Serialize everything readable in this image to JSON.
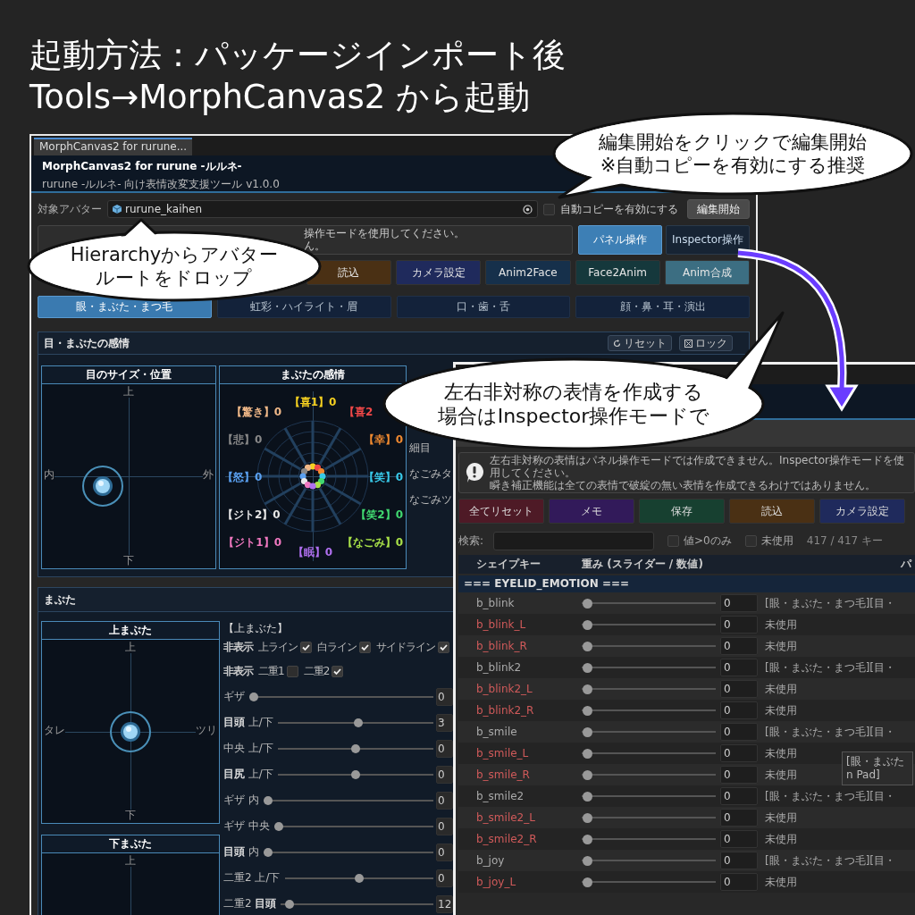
{
  "headline": [
    "起動方法：パッケージインポート後",
    "Tools→MorphCanvas2 から起動"
  ],
  "main_window": {
    "tab": "MorphCanvas2 for rurune...",
    "title": "MorphCanvas2 for rurune -ルルネ-",
    "subtitle": "rurune -ルルネ- 向け表情改変支援ツール v1.0.0",
    "avatar_label": "対象アバター",
    "avatar_field": {
      "value": "rurune_kaihen"
    },
    "auto_copy": {
      "label": "自動コピーを有効にする",
      "checked": false
    },
    "start_button": "編集開始",
    "notice": [
      "操作モードを使用してください。",
      "ん。"
    ],
    "modes": [
      {
        "label": "パネル操作",
        "selected": true
      },
      {
        "label": "Inspector操作",
        "selected": false
      }
    ],
    "buttons": [
      {
        "label": "読込",
        "color": "#4a3014"
      },
      {
        "label": "カメラ設定",
        "color": "#1f2a5c"
      },
      {
        "label": "Anim2Face",
        "color": "#16304b"
      },
      {
        "label": "Face2Anim",
        "color": "#15383c"
      },
      {
        "label": "Anim合成",
        "color": "#3c6e82"
      }
    ],
    "categories": [
      {
        "label": "眼・まぶた・まつ毛",
        "selected": true
      },
      {
        "label": "虹彩・ハイライト・眉",
        "selected": false
      },
      {
        "label": "口・歯・舌",
        "selected": false
      },
      {
        "label": "顔・鼻・耳・演出",
        "selected": false
      }
    ],
    "eye_emotion": {
      "title": "目・まぶたの感情",
      "actions": [
        "リセット",
        "ロック"
      ],
      "position_pad": {
        "title": "目のサイズ・位置",
        "top": "上",
        "left": "内",
        "right": "外",
        "bottom": "下"
      },
      "radar": {
        "title": "まぶたの感情",
        "emotions": [
          {
            "label": "【喜1】0",
            "color": "#f5d020"
          },
          {
            "label": "【驚き】0",
            "color": "#f0b888"
          },
          {
            "label": "【喜2",
            "color": "#f04848"
          },
          {
            "label": "【悲】0",
            "color": "#888888"
          },
          {
            "label": "【幸】0",
            "color": "#f08a30"
          },
          {
            "label": "【怒】0",
            "color": "#5aa0f0"
          },
          {
            "label": "【笑】0",
            "color": "#38c8e8"
          },
          {
            "label": "【ジト2】0",
            "color": "#e8e8e8"
          },
          {
            "label": "【笑2】0",
            "color": "#40d870"
          },
          {
            "label": "【ジト1】0",
            "color": "#f078c0"
          },
          {
            "label": "【なごみ】0",
            "color": "#a8e048"
          },
          {
            "label": "【眠】0",
            "color": "#b070f0"
          }
        ]
      },
      "side_labels": [
        "細目",
        "なごみタ",
        "なごみツ"
      ]
    },
    "eyelid": {
      "title": "まぶた",
      "upper_pad": {
        "title": "上まぶた",
        "top": "上",
        "left": "タレ",
        "right": "ツリ",
        "bottom": "下"
      },
      "lower_pad": {
        "title": "下まぶた",
        "top": "上"
      },
      "heading": "【上まぶた】",
      "hide_rows": [
        {
          "label": "非表示",
          "options": [
            {
              "label": "上ライン",
              "checked": true
            },
            {
              "label": "白ライン",
              "checked": true
            },
            {
              "label": "サイドライン",
              "checked": true
            }
          ]
        },
        {
          "label": "非表示",
          "options": [
            {
              "label": "二重1",
              "checked": false
            },
            {
              "label": "二重2",
              "checked": true
            }
          ]
        }
      ],
      "sliders": [
        {
          "label": "ギザ",
          "level": 0,
          "value": "0"
        },
        {
          "label": "**目頭** 上/下",
          "level": 0.52,
          "value": "3"
        },
        {
          "label": "中央 上/下",
          "level": 0.5,
          "value": "0"
        },
        {
          "label": "**目尻** 上/下",
          "level": 0.5,
          "value": "0"
        },
        {
          "label": "ギザ 内",
          "level": 0,
          "value": "0"
        },
        {
          "label": "ギザ 中央",
          "level": 0,
          "value": "0"
        },
        {
          "label": "**目頭** 内",
          "level": 0,
          "value": "0"
        },
        {
          "label": "二重2 上/下",
          "level": 0.5,
          "value": "0"
        },
        {
          "label": "二重2 **目頭**",
          "level": 0.03,
          "value": "12"
        }
      ]
    }
  },
  "inspector_window": {
    "notice": [
      "左右非対称の表情はパネル操作モードでは作成できません。Inspector操作モードを使用してください。",
      "瞬き補正機能は全ての表情で破綻の無い表情を作成できるわけではありません。"
    ],
    "buttons": [
      {
        "label": "全てリセット",
        "color": "#4e1a26"
      },
      {
        "label": "メモ",
        "color": "#321a5a"
      },
      {
        "label": "保存",
        "color": "#174030"
      },
      {
        "label": "読込",
        "color": "#4a3014"
      },
      {
        "label": "カメラ設定",
        "color": "#1f2a5c"
      }
    ],
    "search": {
      "label": "検索:"
    },
    "filters": [
      {
        "label": "値>0のみ",
        "checked": false
      },
      {
        "label": "未使用",
        "checked": false
      }
    ],
    "count": "417 / 417 キー",
    "columns": [
      "シェイプキー",
      "重み (スライダー / 数値)",
      "パ"
    ],
    "group": "=== EYELID_EMOTION ===",
    "rows": [
      {
        "name": "b_blink",
        "unused": false,
        "level": 0,
        "value": "0",
        "panel": "[眼・まぶた・まつ毛][目・"
      },
      {
        "name": "b_blink_L",
        "unused": true,
        "level": 0,
        "value": "0",
        "panel": "未使用"
      },
      {
        "name": "b_blink_R",
        "unused": true,
        "level": 0,
        "value": "0",
        "panel": "未使用"
      },
      {
        "name": "b_blink2",
        "unused": false,
        "level": 0,
        "value": "0",
        "panel": "[眼・まぶた・まつ毛][目・"
      },
      {
        "name": "b_blink2_L",
        "unused": true,
        "level": 0,
        "value": "0",
        "panel": "未使用"
      },
      {
        "name": "b_blink2_R",
        "unused": true,
        "level": 0,
        "value": "0",
        "panel": "未使用"
      },
      {
        "name": "b_smile",
        "unused": false,
        "level": 0,
        "value": "0",
        "panel": "[眼・まぶた・まつ毛][目・"
      },
      {
        "name": "b_smile_L",
        "unused": true,
        "level": 0,
        "value": "0",
        "panel": "未使用"
      },
      {
        "name": "b_smile_R",
        "unused": true,
        "level": 0,
        "value": "0",
        "panel": "未使用"
      },
      {
        "name": "b_smile2",
        "unused": false,
        "level": 0,
        "value": "0",
        "panel": "[眼・まぶた・まつ毛][目・"
      },
      {
        "name": "b_smile2_L",
        "unused": true,
        "level": 0,
        "value": "0",
        "panel": "未使用"
      },
      {
        "name": "b_smile2_R",
        "unused": true,
        "level": 0,
        "value": "0",
        "panel": "未使用"
      },
      {
        "name": "b_joy",
        "unused": false,
        "level": 0,
        "value": "0",
        "panel": "[眼・まぶた・まつ毛][目・"
      },
      {
        "name": "b_joy_L",
        "unused": true,
        "level": 0,
        "value": "0",
        "panel": "未使用"
      }
    ],
    "tooltip": [
      "[眼・まぶた",
      "n Pad]"
    ]
  },
  "callouts": [
    {
      "text": [
        "編集開始をクリックで編集開始",
        "※自動コピーを有効にする推奨"
      ]
    },
    {
      "text": [
        "Hierarchyからアバター",
        "ルートをドロップ"
      ]
    },
    {
      "text": [
        "左右非対称の表情を作成する",
        "場合はInspector操作モードで"
      ]
    }
  ]
}
